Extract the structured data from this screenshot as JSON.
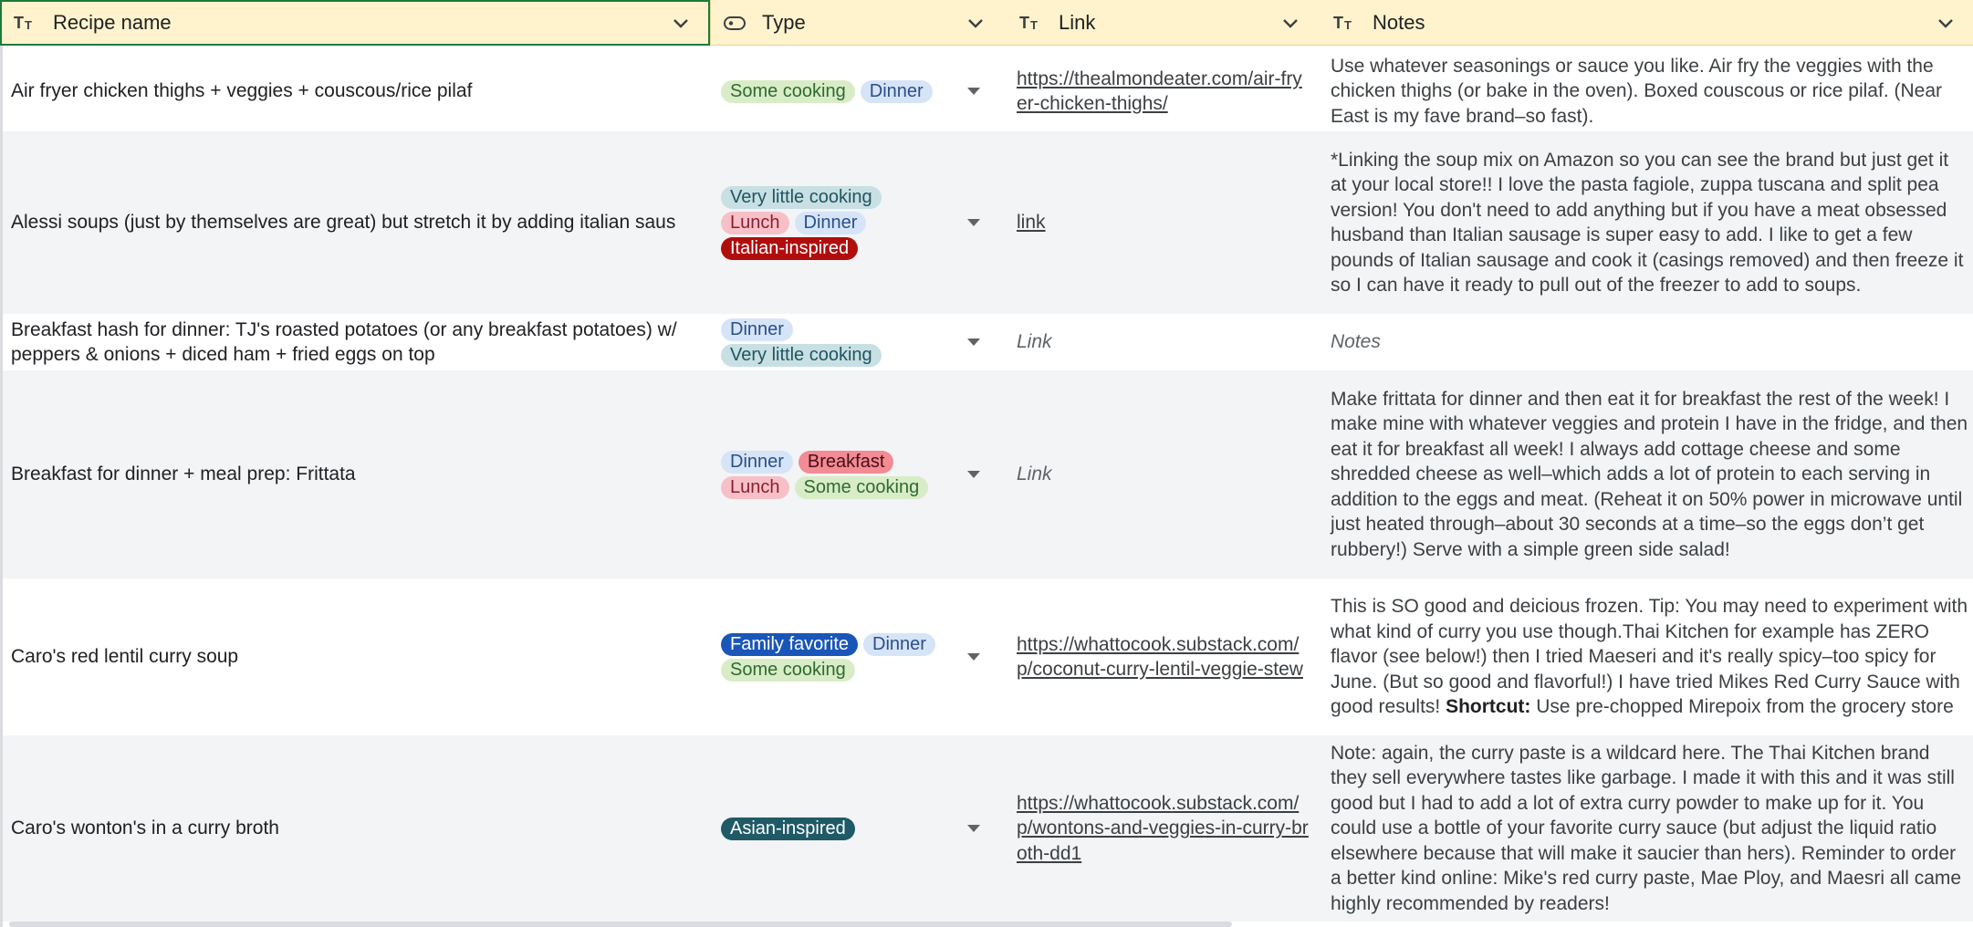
{
  "header": {
    "columns": [
      {
        "label": "Recipe name",
        "icon": "text-type-icon"
      },
      {
        "label": "Type",
        "icon": "select-type-icon"
      },
      {
        "label": "Link",
        "icon": "text-type-icon"
      },
      {
        "label": "Notes",
        "icon": "text-type-icon"
      }
    ]
  },
  "colors": {
    "header_bg": "#fff3cd",
    "selected_border": "#1e7a3c",
    "chip_some_cooking": "#d9ecc8",
    "chip_dinner": "#d6e4f7",
    "chip_very_little_cooking": "#c8dfe3",
    "chip_lunch": "#f7c0c8",
    "chip_italian": "#b10d0d",
    "chip_breakfast": "#f28b94",
    "chip_family_favorite": "#1a56b8",
    "chip_asian": "#1f5a66"
  },
  "rows": [
    {
      "name": "Air fryer chicken thighs + veggies + couscous/rice pilaf",
      "types": [
        {
          "label": "Some cooking",
          "bg": "#d9ecc8",
          "fg": "#2e6b2e"
        },
        {
          "label": "Dinner",
          "bg": "#d6e4f7",
          "fg": "#2b4f8a"
        }
      ],
      "link": "https://thealmondeater.com/air-fryer-chicken-thighs/",
      "link_is_placeholder": false,
      "notes": "Use whatever seasonings or sauce you like. Air fry the veggies with the chicken thighs (or bake in the oven). Boxed couscous or rice pilaf. (Near East is my fave brand–so fast)."
    },
    {
      "name": "Alessi soups (just by themselves are great) but stretch it by adding italian saus",
      "types": [
        {
          "label": "Very little cooking",
          "bg": "#c8dfe3",
          "fg": "#1f5560"
        },
        {
          "label": "Lunch",
          "bg": "#f7c0c8",
          "fg": "#8a1f2e"
        },
        {
          "label": "Dinner",
          "bg": "#d6e4f7",
          "fg": "#2b4f8a"
        },
        {
          "label": "Italian-inspired",
          "bg": "#b10d0d",
          "fg": "#ffffff"
        }
      ],
      "link": "link",
      "link_is_placeholder": false,
      "notes": "*Linking the soup mix on Amazon so you can see the brand but just get it at your local store!! I love the pasta fagiole, zuppa tuscana and split pea version! You don't need to add anything but if you have a meat obsessed husband than Italian sausage is super easy to add. I like to get a few pounds of Italian sausage and cook it (casings removed) and then freeze it so I can have it ready to pull out of the freezer to add to soups."
    },
    {
      "name": "Breakfast hash for dinner: TJ's roasted potatoes (or any breakfast potatoes) w/ peppers & onions + diced ham + fried eggs on top",
      "types": [
        {
          "label": "Dinner",
          "bg": "#d6e4f7",
          "fg": "#2b4f8a"
        },
        {
          "label": "Very little cooking",
          "bg": "#c8dfe3",
          "fg": "#1f5560"
        }
      ],
      "link": "Link",
      "link_is_placeholder": true,
      "notes": "Notes",
      "notes_is_placeholder": true
    },
    {
      "name": "Breakfast for dinner + meal prep: Frittata",
      "types": [
        {
          "label": "Dinner",
          "bg": "#d6e4f7",
          "fg": "#2b4f8a"
        },
        {
          "label": "Breakfast",
          "bg": "#f28b94",
          "fg": "#4a0d14"
        },
        {
          "label": "Lunch",
          "bg": "#f7c0c8",
          "fg": "#8a1f2e"
        },
        {
          "label": "Some cooking",
          "bg": "#d9ecc8",
          "fg": "#2e6b2e"
        }
      ],
      "link": "Link",
      "link_is_placeholder": true,
      "notes": "Make frittata for dinner and then eat it for breakfast the rest of the week! I make mine with whatever veggies and protein I have in the fridge, and then eat it for breakfast all week! I always add cottage cheese and some shredded cheese as well–which adds a lot of protein to each serving in addition to the eggs and meat. (Reheat it on 50% power in microwave until just heated through–about 30 seconds at a time–so the eggs don’t get rubbery!) Serve with a simple green side salad!"
    },
    {
      "name": "Caro's red lentil curry soup",
      "types": [
        {
          "label": "Family favorite",
          "bg": "#1a56b8",
          "fg": "#ffffff"
        },
        {
          "label": "Dinner",
          "bg": "#d6e4f7",
          "fg": "#2b4f8a"
        },
        {
          "label": "Some cooking",
          "bg": "#d9ecc8",
          "fg": "#2e6b2e"
        }
      ],
      "link": "https://whattocook.substack.com/p/coconut-curry-lentil-veggie-stew",
      "link_is_placeholder": false,
      "notes_pre": "This is SO good and deicious frozen. Tip: You may need to experiment with what kind of curry you use though.Thai Kitchen for example has ZERO flavor (see below!) then I tried Maeseri and it's really spicy–too spicy for June. (But so good and flavorful!) I have tried Mikes Red Curry Sauce with good results! ",
      "notes_bold": "Shortcut:",
      "notes_post": " Use pre-chopped Mirepoix from the grocery store"
    },
    {
      "name": "Caro's wonton's in a curry broth",
      "types": [
        {
          "label": "Asian-inspired",
          "bg": "#1f5a66",
          "fg": "#ffffff"
        }
      ],
      "link": "https://whattocook.substack.com/p/wontons-and-veggies-in-curry-broth-dd1",
      "link_is_placeholder": false,
      "notes": "Note: again, the curry paste is a wildcard here. The Thai Kitchen brand they sell everywhere tastes like garbage. I made it with this and it was still good but I had to add a lot of extra curry powder to make up for it. You could use a bottle of your favorite curry sauce (but adjust the liquid ratio elsewhere because that will make it saucier than hers). Reminder to order a better kind online: Mike's red curry paste, Mae Ploy, and Maesri all came highly recommended by readers!"
    }
  ]
}
